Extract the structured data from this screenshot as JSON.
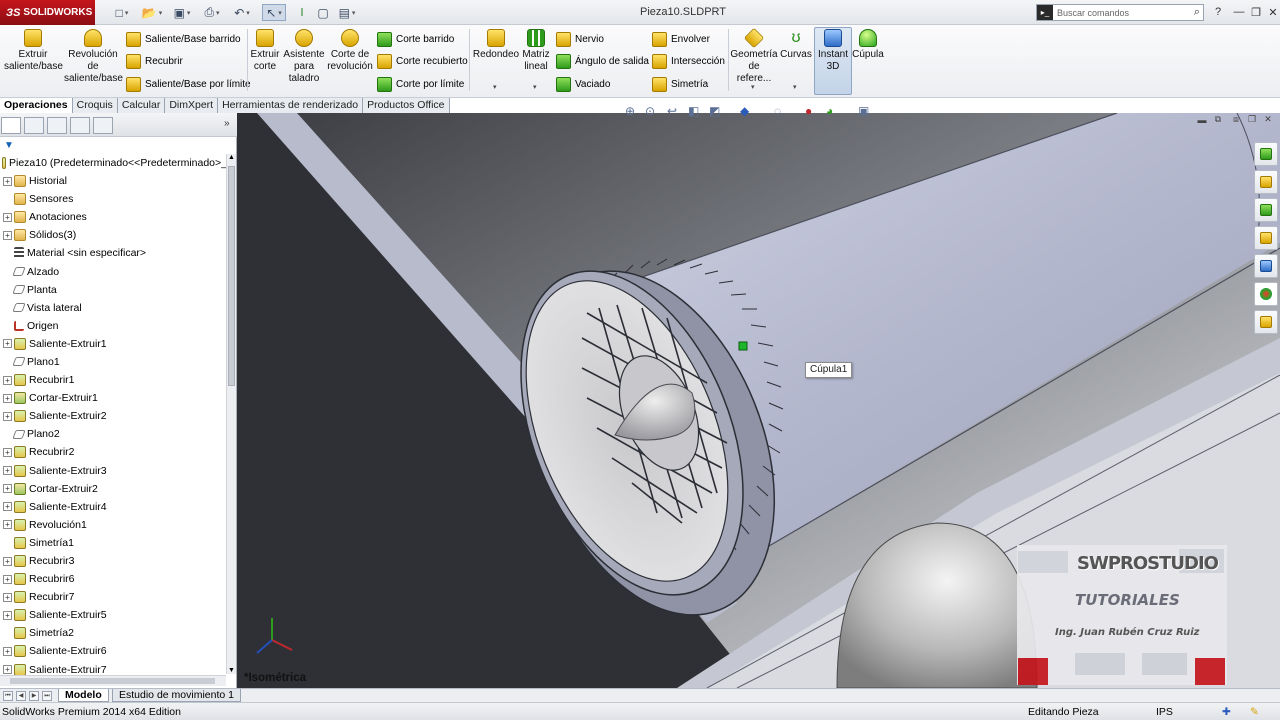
{
  "app": {
    "logo_text": "SOLIDWORKS",
    "doc_title": "Pieza10.SLDPRT",
    "search_placeholder": "Buscar comandos",
    "help_icon": "?",
    "window_controls": [
      "minimize-icon",
      "restore-icon",
      "close-icon"
    ]
  },
  "toolbar": {
    "extruir_saliente": "Extruir saliente/base",
    "revolucion_saliente": "Revolución de saliente/base",
    "saliente_barrido": "Saliente/Base barrido",
    "recubrir": "Recubrir",
    "saliente_limite": "Saliente/Base por límite",
    "extruir_corte": "Extruir corte",
    "asistente_taladro": "Asistente para taladro",
    "corte_revolucion": "Corte de revolución",
    "corte_barrido": "Corte barrido",
    "corte_recubierto": "Corte recubierto",
    "corte_limite": "Corte por límite",
    "redondeo": "Redondeo",
    "matriz_lineal": "Matriz lineal",
    "nervio": "Nervio",
    "angulo_salida": "Ángulo de salida",
    "vaciado": "Vaciado",
    "envolver": "Envolver",
    "interseccion": "Intersección",
    "simetria": "Simetría",
    "geometria_referencia": "Geometría de refere...",
    "curvas": "Curvas",
    "instant3d": "Instant 3D",
    "cupula": "Cúpula"
  },
  "tabs": [
    "Operaciones",
    "Croquis",
    "Calcular",
    "DimXpert",
    "Herramientas de renderizado",
    "Productos Office"
  ],
  "tree": {
    "root": "Pieza10  (Predeterminado<<Predeterminado>_",
    "items": [
      {
        "label": "Historial",
        "icon": "folder",
        "exp": true
      },
      {
        "label": "Sensores",
        "icon": "folder",
        "exp": false
      },
      {
        "label": "Anotaciones",
        "icon": "folder",
        "exp": true
      },
      {
        "label": "Sólidos(3)",
        "icon": "folder",
        "exp": true
      },
      {
        "label": "Material <sin especificar>",
        "icon": "mat",
        "exp": false
      },
      {
        "label": "Alzado",
        "icon": "plane",
        "exp": false
      },
      {
        "label": "Planta",
        "icon": "plane",
        "exp": false
      },
      {
        "label": "Vista lateral",
        "icon": "plane",
        "exp": false
      },
      {
        "label": "Origen",
        "icon": "origin",
        "exp": false
      },
      {
        "label": "Saliente-Extruir1",
        "icon": "feat",
        "exp": true
      },
      {
        "label": "Plano1",
        "icon": "plane",
        "exp": false
      },
      {
        "label": "Recubrir1",
        "icon": "feat",
        "exp": true
      },
      {
        "label": "Cortar-Extruir1",
        "icon": "cut",
        "exp": true
      },
      {
        "label": "Saliente-Extruir2",
        "icon": "feat",
        "exp": true
      },
      {
        "label": "Plano2",
        "icon": "plane",
        "exp": false
      },
      {
        "label": "Recubrir2",
        "icon": "feat",
        "exp": true
      },
      {
        "label": "Saliente-Extruir3",
        "icon": "feat",
        "exp": true
      },
      {
        "label": "Cortar-Extruir2",
        "icon": "cut",
        "exp": true
      },
      {
        "label": "Saliente-Extruir4",
        "icon": "feat",
        "exp": true
      },
      {
        "label": "Revolución1",
        "icon": "feat",
        "exp": true
      },
      {
        "label": "Simetría1",
        "icon": "feat",
        "exp": false
      },
      {
        "label": "Recubrir3",
        "icon": "feat",
        "exp": true
      },
      {
        "label": "Recubrir6",
        "icon": "feat",
        "exp": true
      },
      {
        "label": "Recubrir7",
        "icon": "feat",
        "exp": true
      },
      {
        "label": "Saliente-Extruir5",
        "icon": "feat",
        "exp": true
      },
      {
        "label": "Simetría2",
        "icon": "feat",
        "exp": false
      },
      {
        "label": "Saliente-Extruir6",
        "icon": "feat",
        "exp": true
      },
      {
        "label": "Saliente-Extruir7",
        "icon": "feat",
        "exp": true
      }
    ]
  },
  "viewport": {
    "tooltip": "Cúpula1",
    "view_name": "*Isométrica",
    "watermark_title": "SWPROSTUDIO",
    "watermark_sub": "TUTORIALES",
    "watermark_author": "Ing. Juan Rubén Cruz Ruiz"
  },
  "bottom_tabs": [
    "Modelo",
    "Estudio de movimiento 1"
  ],
  "status": {
    "edition": "SolidWorks Premium 2014 x64 Edition",
    "mode": "Editando Pieza",
    "units": "IPS"
  },
  "colors": {
    "brand": "#c4161c",
    "model_surface": "#b9bdd1",
    "selection_green": "#1fb52a"
  }
}
